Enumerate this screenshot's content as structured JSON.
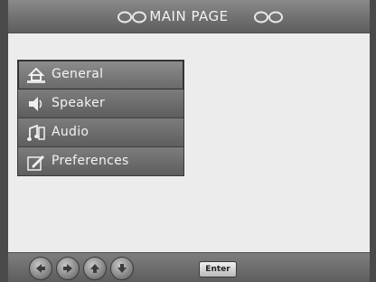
{
  "title": "MAIN PAGE",
  "menu": {
    "items": [
      {
        "label": "General",
        "icon": "house-icon",
        "selected": true
      },
      {
        "label": "Speaker",
        "icon": "speaker-icon",
        "selected": false
      },
      {
        "label": "Audio",
        "icon": "audio-icon",
        "selected": false
      },
      {
        "label": "Preferences",
        "icon": "preferences-icon",
        "selected": false
      }
    ]
  },
  "bottom_bar": {
    "buttons": [
      {
        "icon": "arrow-left-icon"
      },
      {
        "icon": "arrow-right-icon"
      },
      {
        "icon": "arrow-up-icon"
      },
      {
        "icon": "arrow-down-icon"
      }
    ],
    "enter_label": "Enter"
  },
  "colors": {
    "title_bar": "#6e6e6e",
    "background": "#ececec",
    "menu_item": "#6a6a6a",
    "text_light": "#f3f3f3"
  }
}
